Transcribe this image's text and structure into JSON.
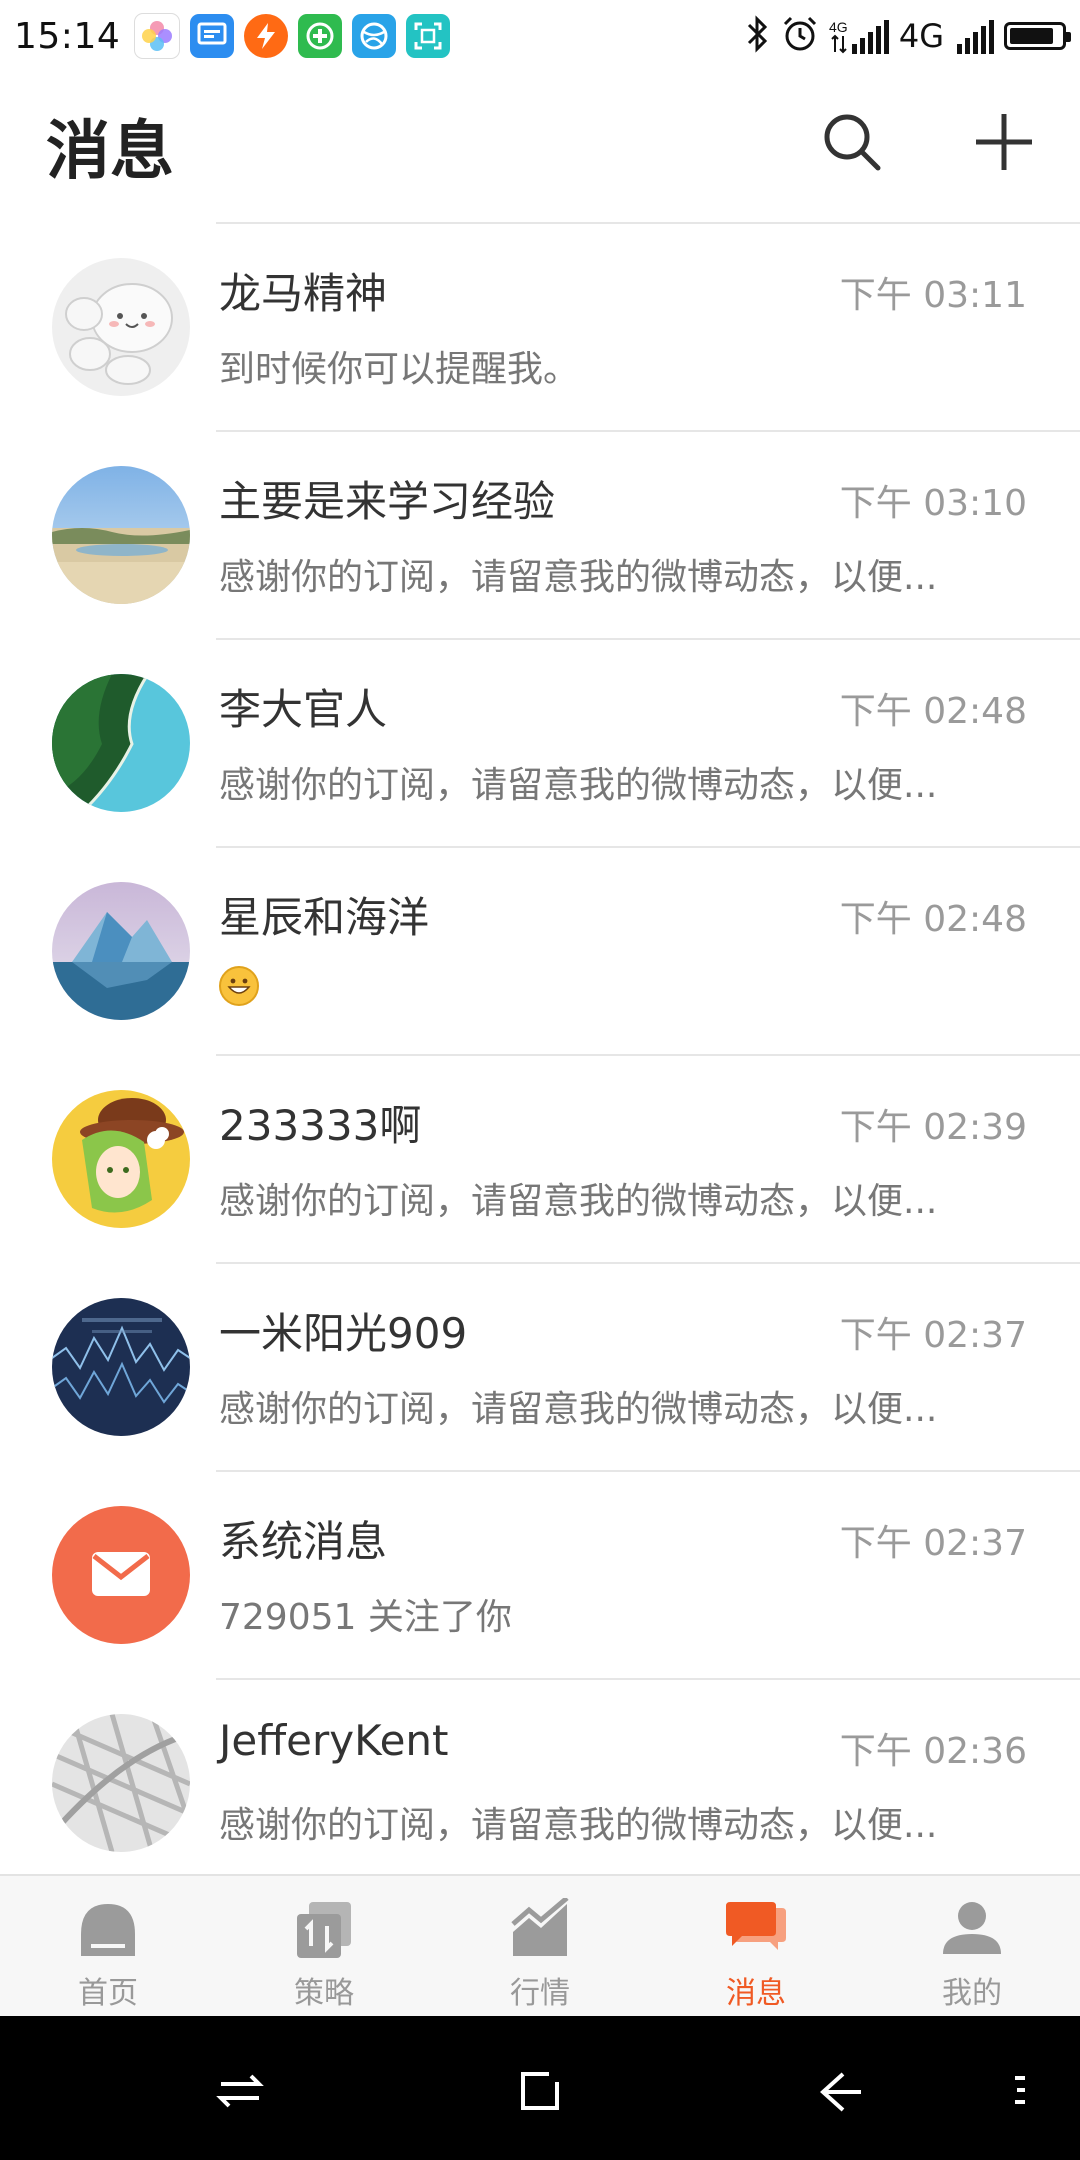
{
  "status_bar": {
    "time": "15:14",
    "app_icons": [
      "photos-app-icon",
      "message-app-icon",
      "flash-app-icon",
      "add-app-icon",
      "ball-app-icon",
      "scan-app-icon"
    ],
    "network_1": "4G",
    "network_2": "4G",
    "battery_level": 0.85
  },
  "header": {
    "title": "消息",
    "search_icon": "search-icon",
    "add_icon": "plus-icon"
  },
  "messages": [
    {
      "name": "龙马精神",
      "time": "下午 03:11",
      "preview": "到时候你可以提醒我。"
    },
    {
      "name": "主要是来学习经验",
      "time": "下午 03:10",
      "preview": "感谢你的订阅，请留意我的微博动态，以便..."
    },
    {
      "name": "李大官人",
      "time": "下午 02:48",
      "preview": "感谢你的订阅，请留意我的微博动态，以便..."
    },
    {
      "name": "星辰和海洋",
      "time": "下午 02:48",
      "preview": "",
      "preview_icon": "grinning-emoji-icon"
    },
    {
      "name": "233333啊",
      "time": "下午 02:39",
      "preview": "感谢你的订阅，请留意我的微博动态，以便..."
    },
    {
      "name": "一米阳光909",
      "time": "下午 02:37",
      "preview": "感谢你的订阅，请留意我的微博动态，以便..."
    },
    {
      "name": "系统消息",
      "time": "下午 02:37",
      "preview": "729051 关注了你"
    },
    {
      "name": "JefferyKent",
      "time": "下午 02:36",
      "preview": "感谢你的订阅，请留意我的微博动态，以便..."
    }
  ],
  "bottom_nav": [
    {
      "label": "首页",
      "icon": "home-icon"
    },
    {
      "label": "策略",
      "icon": "strategy-icon"
    },
    {
      "label": "行情",
      "icon": "market-chart-icon"
    },
    {
      "label": "消息",
      "icon": "messages-icon",
      "active": true
    },
    {
      "label": "我的",
      "icon": "profile-icon"
    }
  ],
  "colors": {
    "accent": "#f05a24",
    "system_message_avatar": "#f26b4b",
    "inactive_icon": "#9b9b9b"
  }
}
